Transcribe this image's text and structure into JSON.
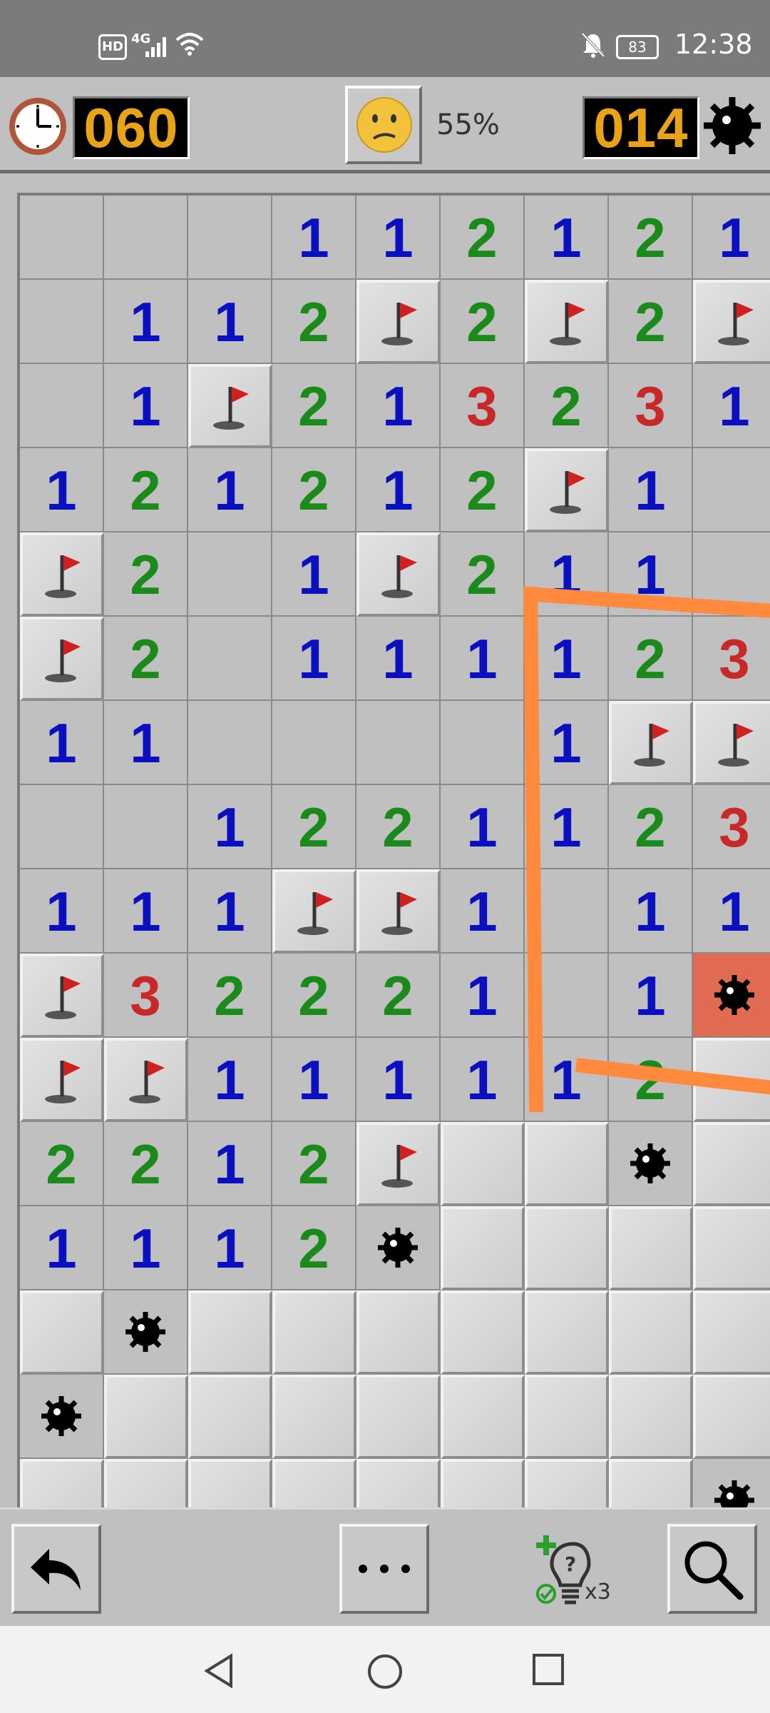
{
  "status_bar": {
    "time": "12:38",
    "battery": "83",
    "network": "4G",
    "hd": "HD",
    "icons": [
      "hd-icon",
      "signal-icon",
      "wifi-icon",
      "mute-bell-icon",
      "battery-icon"
    ]
  },
  "header": {
    "timer": "060",
    "progress": "55%",
    "mines_left": "014",
    "face": "worried-face",
    "lcd_color": "#e8a317"
  },
  "board": {
    "visible_columns": 9,
    "visible_rows": 16,
    "legend": "blank=open empty, digit=count, F=flag, M=revealed mine, X=exploded mine, C=covered",
    "rows": [
      [
        " ",
        " ",
        " ",
        "1",
        "1",
        "2",
        "1",
        "2",
        "1"
      ],
      [
        " ",
        "1",
        "1",
        "2",
        "F",
        "2",
        "F",
        "2",
        "F"
      ],
      [
        " ",
        "1",
        "F",
        "2",
        "1",
        "3",
        "2",
        "3",
        "1"
      ],
      [
        "1",
        "2",
        "1",
        "2",
        "1",
        "2",
        "F",
        "1",
        " "
      ],
      [
        "F",
        "2",
        " ",
        "1",
        "F",
        "2",
        "1",
        "1",
        " "
      ],
      [
        "F",
        "2",
        " ",
        "1",
        "1",
        "1",
        "1",
        "2",
        "3"
      ],
      [
        "1",
        "1",
        " ",
        " ",
        " ",
        " ",
        "1",
        "F",
        "F"
      ],
      [
        " ",
        " ",
        "1",
        "2",
        "2",
        "1",
        "1",
        "2",
        "3"
      ],
      [
        "1",
        "1",
        "1",
        "F",
        "F",
        "1",
        " ",
        "1",
        "1"
      ],
      [
        "F",
        "3",
        "2",
        "2",
        "2",
        "1",
        " ",
        "1",
        "X"
      ],
      [
        "F",
        "F",
        "1",
        "1",
        "1",
        "1",
        "1",
        "2",
        "C"
      ],
      [
        "2",
        "2",
        "1",
        "2",
        "F",
        "C",
        "C",
        "M",
        "C"
      ],
      [
        "1",
        "1",
        "1",
        "2",
        "M",
        "C",
        "C",
        "C",
        "C"
      ],
      [
        "C",
        "M",
        "C",
        "C",
        "C",
        "C",
        "C",
        "C",
        "C"
      ],
      [
        "M",
        "C",
        "C",
        "C",
        "C",
        "C",
        "C",
        "C",
        "C"
      ],
      [
        "C",
        "C",
        "C",
        "C",
        "C",
        "C",
        "C",
        "C",
        "M"
      ]
    ],
    "number_colors": {
      "1": "#0a10c0",
      "2": "#1a8a1a",
      "3": "#c82828"
    },
    "annotation_color": "#ff8a3d"
  },
  "toolbar": {
    "hint_count": "x3",
    "icons": [
      "undo-arrow-icon",
      "more-dots-icon",
      "hint-bulb-icon",
      "magnifier-icon"
    ]
  },
  "nav": {
    "icons": [
      "back-triangle-icon",
      "home-circle-icon",
      "recents-square-icon"
    ]
  }
}
